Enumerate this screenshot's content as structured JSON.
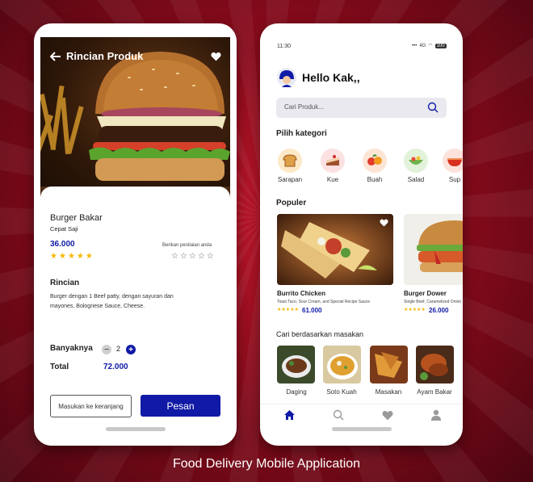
{
  "detail_screen": {
    "header_title": "Rincian Produk",
    "product_name": "Burger Bakar",
    "product_subtitle": "Cepat Saji",
    "price": "36.000",
    "rating": 5,
    "rating_prompt": "Berikan penilaian anda",
    "description_title": "Rincian",
    "description_text_line1": "Burger dengan 1 Beef patty, dengan sayuran dan",
    "description_text_line2": "mayones, Bolognese Sauce, Cheese.",
    "quantity_label": "Banyaknya",
    "quantity_value": "2",
    "total_label": "Total",
    "total_value": "72.000",
    "add_to_cart_label": "Masukan ke keranjang",
    "order_label": "Pesan"
  },
  "home_screen": {
    "status_time": "11:30",
    "status_network": "4G",
    "status_battery": "100",
    "greeting": "Hello Kak,,",
    "search_placeholder": "Cari Produk...",
    "categories_title": "Pilih kategori",
    "categories": [
      {
        "label": "Sarapan",
        "icon": "bread-icon"
      },
      {
        "label": "Kue",
        "icon": "cake-icon"
      },
      {
        "label": "Buah",
        "icon": "fruit-icon"
      },
      {
        "label": "Salad",
        "icon": "salad-icon"
      },
      {
        "label": "Sup",
        "icon": "soup-icon"
      }
    ],
    "popular_title": "Populer",
    "popular_items": [
      {
        "name": "Burrito Chicken",
        "desc": "Toast Taco, Sour Cream, and Special Recipe Sauce",
        "price": "61.000",
        "rating": 5
      },
      {
        "name": "Burger Dower",
        "desc": "Single Beef, Caramelized Onion",
        "price": "26.000",
        "rating": 5
      }
    ],
    "cuisine_title": "Cari berdasarkan masakan",
    "cuisines": [
      {
        "label": "Daging"
      },
      {
        "label": "Soto Kuah"
      },
      {
        "label": "Masakan"
      },
      {
        "label": "Ayam Bakar"
      }
    ],
    "nav_items": [
      "home-icon",
      "search-icon",
      "heart-icon",
      "profile-icon"
    ]
  },
  "caption": "Food Delivery Mobile Application",
  "colors": {
    "accent": "#101aa6",
    "star": "#f5b800",
    "background": "#a3101f"
  }
}
